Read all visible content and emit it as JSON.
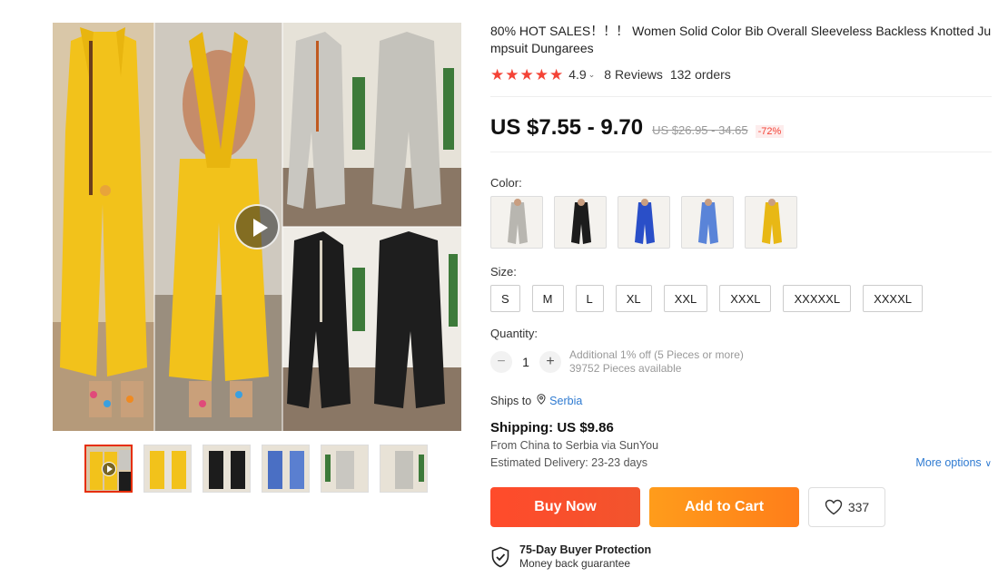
{
  "product": {
    "title": "80% HOT SALES！！！ Women Solid Color Bib Overall Sleeveless Backless Knotted Jumpsuit Dungarees",
    "rating": "4.9",
    "reviews": "8 Reviews",
    "orders": "132 orders"
  },
  "price": {
    "current": "US $7.55 - 9.70",
    "original": "US $26.95 - 34.65",
    "discount": "-72%"
  },
  "colors": {
    "label": "Color:",
    "options": [
      "gray",
      "black",
      "royal-blue",
      "denim-blue",
      "yellow"
    ]
  },
  "sizes": {
    "label": "Size:",
    "options": [
      "S",
      "M",
      "L",
      "XL",
      "XXL",
      "XXXL",
      "XXXXXL",
      "XXXXL"
    ]
  },
  "quantity": {
    "label": "Quantity:",
    "value": "1",
    "decrement": "−",
    "increment": "+",
    "discount_note": "Additional 1% off (5 Pieces or more)",
    "available": "39752 Pieces available"
  },
  "shipping": {
    "ships_to_label": "Ships to",
    "country": "Serbia",
    "cost": "Shipping: US $9.86",
    "route": "From China to Serbia via SunYou",
    "estimated": "Estimated Delivery: 23-23 days",
    "more_options": "More options"
  },
  "actions": {
    "buy_now": "Buy Now",
    "add_to_cart": "Add to Cart",
    "wishlist_count": "337"
  },
  "protection": {
    "title": "75-Day Buyer Protection",
    "subtitle": "Money back guarantee"
  },
  "gallery": {
    "thumbnails": [
      "thumb-video-yellow",
      "thumb-yellow",
      "thumb-black",
      "thumb-blue",
      "thumb-gray-front",
      "thumb-gray-back"
    ],
    "active_index": 0
  },
  "theme": {
    "accent": "#e62e04",
    "star": "#f44336",
    "buy": "#ff4b2b",
    "cart": "#ff9c1b",
    "link": "#2e7ad1"
  }
}
